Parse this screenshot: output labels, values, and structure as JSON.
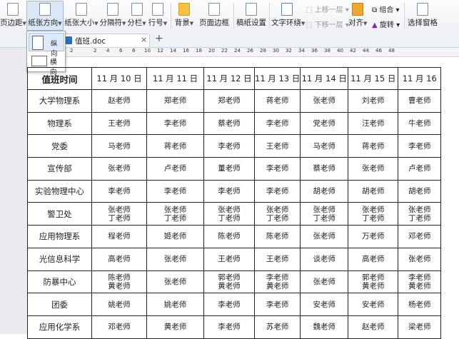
{
  "ribbon": {
    "page_margin": "页边距",
    "orientation": "纸张方向",
    "paper_size": "纸张大小",
    "separator": "分隔符",
    "columns": "分栏",
    "line_numbers": "行号",
    "background": "背景",
    "page_border": "页面边框",
    "manuscript": "稿纸设置",
    "text_wrap": "文字环绕",
    "bring_forward": "上移一层",
    "send_backward": "下移一层",
    "align": "对齐",
    "group": "组合",
    "rotate": "旋转",
    "selection_pane": "选择窗格"
  },
  "dropdown": {
    "portrait": "纵向",
    "landscape": "横向"
  },
  "tab": {
    "doc_name": "值班.doc",
    "close": "×",
    "add": "+"
  },
  "ruler": [
    "2",
    "2",
    "4",
    "6",
    "8",
    "10",
    "12",
    "14",
    "16",
    "18",
    "20",
    "22",
    "24",
    "26",
    "28",
    "30",
    "32",
    "34",
    "36",
    "38",
    "40",
    "42",
    "44",
    "46",
    "48"
  ],
  "table": {
    "header": [
      "值班时间",
      "11 月 10 日",
      "11 月 11 日",
      "11 月 12 日",
      "11 月 13 日",
      "11 月 14 日",
      "11 月 15 日",
      "11 月 16"
    ],
    "rows": [
      [
        "大学物理系",
        "赵老师",
        "郑老师",
        "郑老师",
        "蒋老师",
        "张老师",
        "刘老师",
        "曹老师"
      ],
      [
        "物理系",
        "王老师",
        "李老师",
        "蔡老师",
        "李老师",
        "党老师",
        "汪老师",
        "牛老师"
      ],
      [
        "党委",
        "马老师",
        "蒋老师",
        "李老师",
        "王老师",
        "马老师",
        "蒋老师",
        "李老师"
      ],
      [
        "宣传部",
        "张老师",
        "卢老师",
        "董老师",
        "李老师",
        "蔡老师",
        "张老师",
        "卢老师"
      ],
      [
        "实验物理中心",
        "李老师",
        "李老师",
        "李老师",
        "李老师",
        "胡老师",
        "胡老师",
        "胡老师"
      ],
      [
        "警卫处",
        "张老师 丁老师",
        "张老师 丁老师",
        "张老师 丁老师",
        "张老师 丁老师",
        "张老师 丁老师",
        "张老师 丁老师",
        "张老师 丁老师"
      ],
      [
        "应用物理系",
        "程老师",
        "姬老师",
        "陈老师",
        "陈老师",
        "张老师",
        "万老师",
        "邓老师"
      ],
      [
        "光信息科学",
        "高老师",
        "张老师",
        "王老师",
        "王老师",
        "谈老师",
        "高老师",
        "张老师"
      ],
      [
        "防暴中心",
        "陈老师 黄老师",
        "张老师",
        "郭老师 黄老师",
        "李老师 黄老师",
        "张老师",
        "郭老师 黄老师",
        "李老师 黄老师"
      ],
      [
        "团委",
        "姚老师",
        "姚老师",
        "李老师",
        "李老师",
        "安老师",
        "安老师",
        "杨老师"
      ],
      [
        "应用化学系",
        "邓老师",
        "黄老师",
        "李老师",
        "苏老师",
        "魏老师",
        "赵老师",
        "梁老师"
      ]
    ]
  }
}
